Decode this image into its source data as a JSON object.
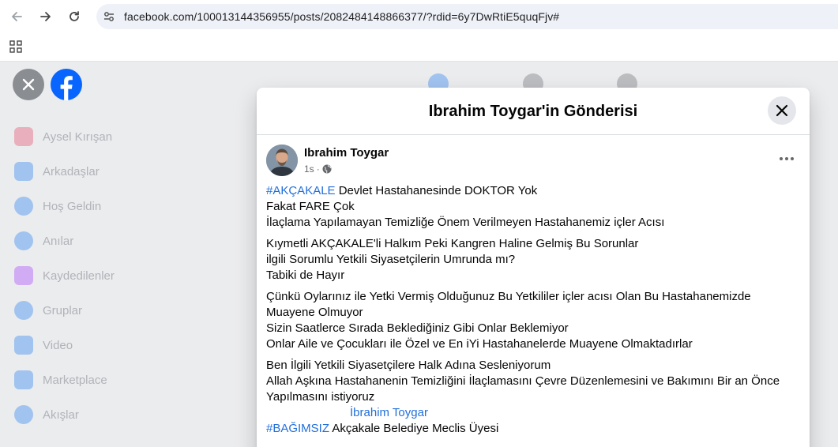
{
  "browser": {
    "url": "facebook.com/100013144356955/posts/2082484148866377/?rdid=6y7DwRtiE5quqFjv#"
  },
  "sidebar": {
    "items": [
      {
        "label": "Aysel Kırışan",
        "color": "#e4405f"
      },
      {
        "label": "Arkadaşlar",
        "color": "#1877f2"
      },
      {
        "label": "Hoş Geldin",
        "color": "#1877f2"
      },
      {
        "label": "Anılar",
        "color": "#1877f2"
      },
      {
        "label": "Kaydedilenler",
        "color": "#a033ff"
      },
      {
        "label": "Gruplar",
        "color": "#1877f2"
      },
      {
        "label": "Video",
        "color": "#1877f2"
      },
      {
        "label": "Marketplace",
        "color": "#1877f2"
      },
      {
        "label": "Akışlar",
        "color": "#1877f2"
      }
    ]
  },
  "dialog": {
    "title": "Ibrahim Toygar'in Gönderisi"
  },
  "post": {
    "author": "Ibrahim Toygar",
    "time": "1s",
    "separator": "·",
    "lines": {
      "l1_tag": "#AKÇAKALE",
      "l1_text": " Devlet Hastahanesinde DOKTOR Yok",
      "l2": "Fakat FARE Çok",
      "l3": "İlaçlama Yapılamayan Temizliğe Önem Verilmeyen Hastahanemiz içler Acısı",
      "l4": "Kıymetli AKÇAKALE'li Halkım Peki Kangren Haline Gelmiş Bu Sorunlar",
      "l5": "ilgili Sorumlu Yetkili Siyasetçilerin Umrunda mı?",
      "l6": "Tabiki de Hayır",
      "l7": "Çünkü Oylarınız ile Yetki Vermiş Olduğunuz Bu Yetkililer içler acısı Olan Bu Hastahanemizde Muayene Olmuyor",
      "l8": "Sizin Saatlerce Sırada Beklediğiniz Gibi Onlar Beklemiyor",
      "l9": "Onlar Aile ve Çocukları ile Özel ve En iYi Hastahanelerde Muayene Olmaktadırlar",
      "l10": "Ben İlgili Yetkili Siyasetçilere Halk Adına Sesleniyorum",
      "l11": "Allah Aşkına Hastahanenin Temizliğini İlaçlamasını Çevre Düzenlemesini ve Bakımını Bir an Önce Yapılmasını istiyoruz",
      "l12_mention": "İbrahim Toygar",
      "l13_tag": "#BAĞIMSIZ",
      "l13_text": " Akçakale Belediye Meclis Üyesi"
    }
  },
  "colors": {
    "link": "#216fdb",
    "fb_blue": "#0866ff"
  }
}
